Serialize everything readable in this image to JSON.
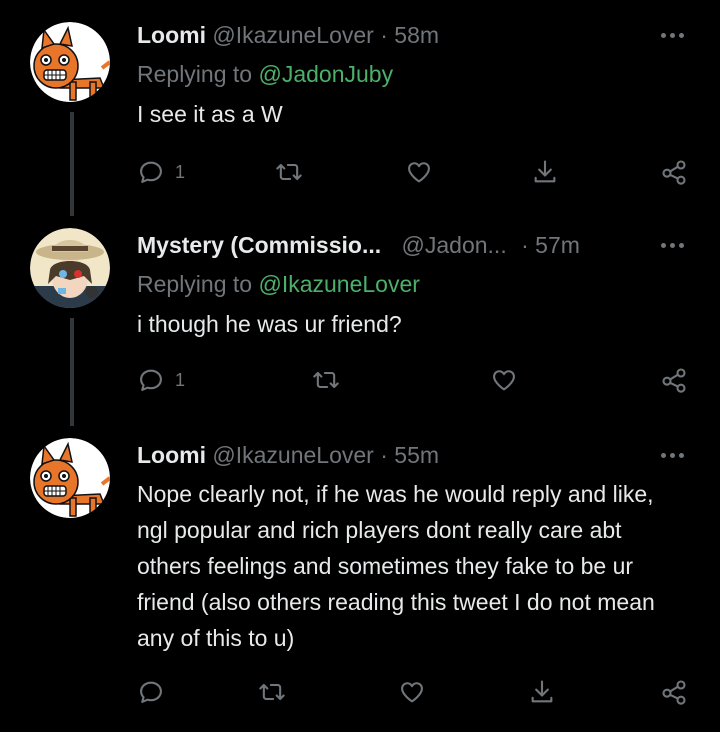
{
  "tweets": [
    {
      "name": "Loomi",
      "handle": "@IkazuneLover",
      "dot": "·",
      "time": "58m",
      "replying_label": "Replying to",
      "replying_to": "@JadonJuby",
      "text": "I see it as a W",
      "reply_count": "1"
    },
    {
      "name": "Mystery (Commissio...",
      "handle": "@Jadon...",
      "dot": "·",
      "time": "57m",
      "replying_label": "Replying to",
      "replying_to": "@IkazuneLover",
      "text": "i though he was ur friend?",
      "reply_count": "1"
    },
    {
      "name": "Loomi",
      "handle": "@IkazuneLover",
      "dot": "·",
      "time": "55m",
      "text": "Nope clearly not, if he was he would reply and like, ngl popular and rich players dont really care abt others feelings and sometimes they fake to be ur friend (also others reading this tweet I do not mean any of this to u)",
      "reply_count": ""
    }
  ],
  "icons": {
    "reply": "speech-bubble-icon",
    "retweet": "retweet-icon",
    "like": "heart-icon",
    "share": "share-icon",
    "more": "more-dots-icon",
    "extra": "nodes-share-icon"
  },
  "colors": {
    "background": "#000000",
    "text": "#e7e9ea",
    "muted": "#71767b",
    "mention": "#4caf6a",
    "thread_line": "#333639",
    "avatar_orange": "#e8762a"
  }
}
